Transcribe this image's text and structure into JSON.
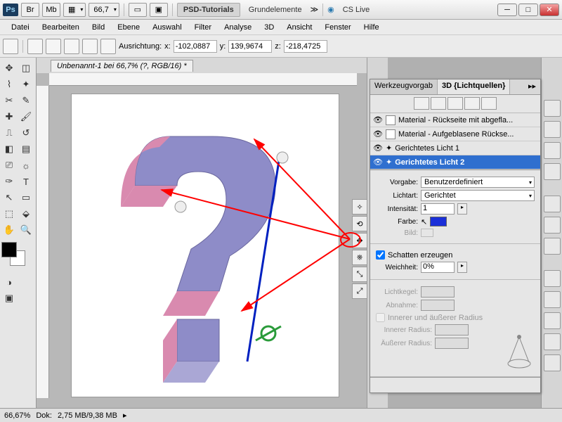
{
  "titlebar": {
    "zoom": "66,7",
    "btn1": "Br",
    "btn2": "Mb",
    "brand": "PSD-Tutorials",
    "workspace": "Grundelemente",
    "cslive": "CS Live"
  },
  "menu": [
    "Datei",
    "Bearbeiten",
    "Bild",
    "Ebene",
    "Auswahl",
    "Filter",
    "Analyse",
    "3D",
    "Ansicht",
    "Fenster",
    "Hilfe"
  ],
  "optbar": {
    "label": "Ausrichtung:",
    "x": "x:",
    "xv": "-102,0887",
    "y": "y:",
    "yv": "139,9674",
    "z": "z:",
    "zv": "-218,4725"
  },
  "doctab": "Unbenannt-1 bei 66,7% (?, RGB/16) *",
  "panel": {
    "tab1": "Werkzeugvorgab",
    "tab2": "3D {Lichtquellen}",
    "layers": [
      "Material - Rückseite mit abgefla...",
      "Material - Aufgeblasene Rückse...",
      "Gerichtetes Licht 1",
      "Gerichtetes Licht 2"
    ],
    "vorgabe_lbl": "Vorgabe:",
    "vorgabe": "Benutzerdefiniert",
    "lichtart_lbl": "Lichtart:",
    "lichtart": "Gerichtet",
    "intensitaet_lbl": "Intensität:",
    "intensitaet": "1",
    "farbe_lbl": "Farbe:",
    "bild_lbl": "Bild:",
    "schatten": "Schatten erzeugen",
    "weichheit_lbl": "Weichheit:",
    "weichheit": "0%",
    "lichtkegel": "Lichtkegel:",
    "abnahme": "Abnahme:",
    "radius_chk": "Innerer und äußerer Radius",
    "innerer": "Innerer Radius:",
    "aeusserer": "Äußerer Radius:"
  },
  "status": {
    "zoom": "66,67%",
    "doc_lbl": "Dok:",
    "doc": "2,75 MB/9,38 MB"
  }
}
